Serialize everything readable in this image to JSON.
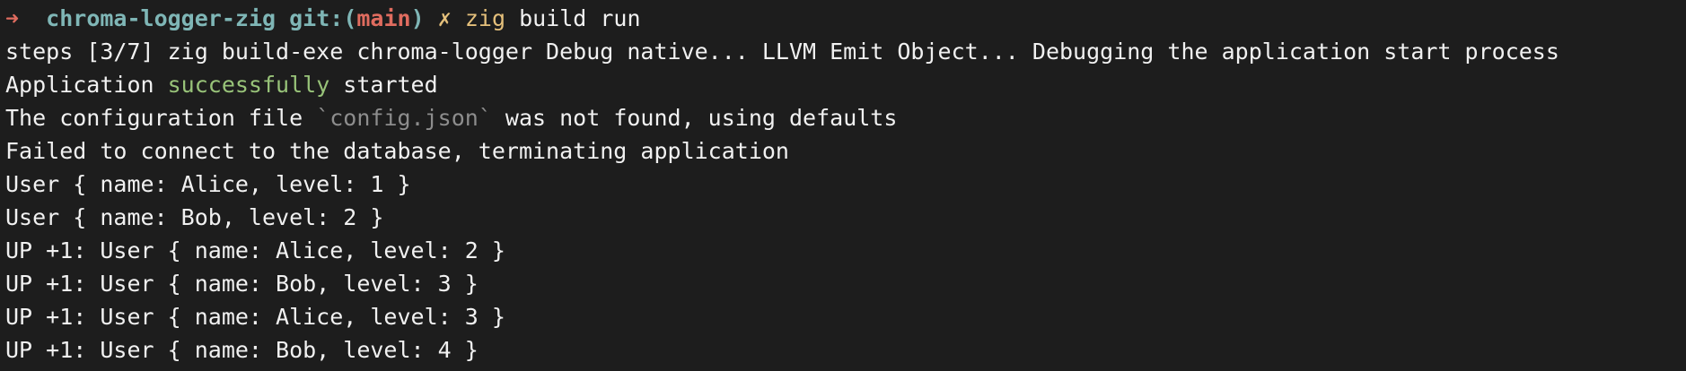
{
  "prompt": {
    "arrow": "➜",
    "directory": "chroma-logger-zig",
    "git_prefix": "git:(",
    "branch": "main",
    "git_suffix": ")",
    "dirty_mark": "✗",
    "command_name": "zig",
    "command_args": "build run"
  },
  "output": {
    "steps_line": "steps [3/7] zig build-exe chroma-logger Debug native... LLVM Emit Object... Debugging the application start process",
    "success_line": {
      "before": "Application ",
      "highlight": "successfully",
      "after": " started"
    },
    "config_line": {
      "before": "The configuration file ",
      "code": "`config.json`",
      "after": " was not found, using defaults"
    },
    "db_line": "Failed to connect to the database, terminating application",
    "users": [
      "User { name: Alice, level: 1 }",
      "User { name: Bob, level: 2 }"
    ],
    "ups": [
      "UP +1: User { name: Alice, level: 2 }",
      "UP +1: User { name: Bob, level: 3 }",
      "UP +1: User { name: Alice, level: 3 }",
      "UP +1: User { name: Bob, level: 4 }"
    ]
  },
  "colors": {
    "background": "#1d1d1d",
    "prompt_arrow": "#e06c5f",
    "directory": "#7fb6b6",
    "branch": "#e06c5f",
    "command": "#e5c07b",
    "success": "#98c379",
    "muted": "#8d8d8d"
  }
}
